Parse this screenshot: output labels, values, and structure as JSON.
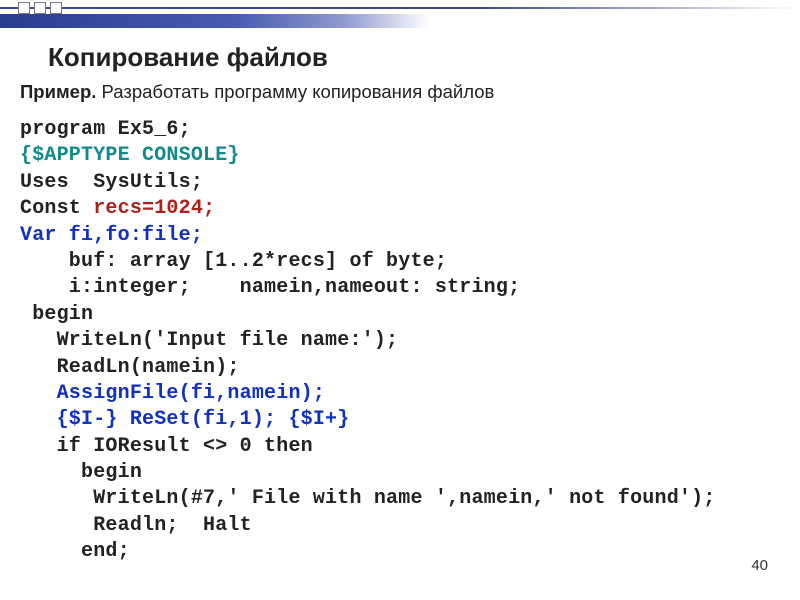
{
  "title": "Копирование файлов",
  "example_label": "Пример.",
  "example_text": " Разработать программу копирования файлов",
  "code": {
    "l01a": "program",
    "l01b": " Ex5_6;",
    "l02": "{$APPTYPE CONSOLE}",
    "l03a": "Uses",
    "l03b": "  SysUtils;",
    "l04a": "Const ",
    "l04b": "recs=1024;",
    "l05a": "Var",
    "l05b": " fi,fo:file;",
    "l06": "    buf: array [1..2*recs] of byte;",
    "l07": "    i:integer;    namein,nameout: string;",
    "l08": " begin",
    "l09": "   WriteLn('Input file name:');",
    "l10": "   ReadLn(namein);",
    "l11": "   AssignFile(fi,namein);",
    "l12a": "   {$I-}",
    "l12b": " ReSet(fi,1); ",
    "l12c": "{$I+}",
    "l13": "   if IOResult <> 0 then",
    "l14": "     begin",
    "l15": "      WriteLn(#7,' File with name ',namein,' not found');",
    "l16": "      Readln;  Halt",
    "l17": "     end;"
  },
  "page_number": "40"
}
